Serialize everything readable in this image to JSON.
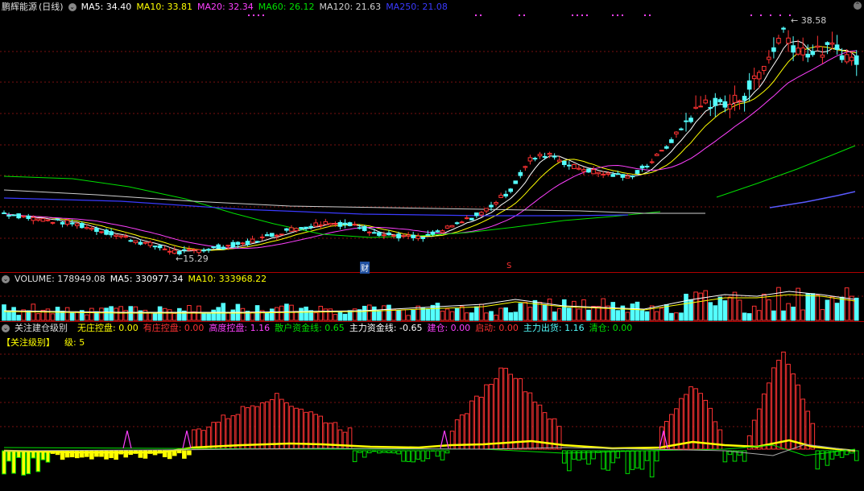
{
  "colors": {
    "up": "#ff3232",
    "down": "#54ffff",
    "ma5": "#ffffff",
    "ma10": "#ffff00",
    "ma20": "#ff40ff",
    "ma60": "#00e000",
    "ma120": "#d0d0d0",
    "ma250": "#3a3aff",
    "grid": "#7a1010"
  },
  "price_panel": {
    "title": "鹏辉能源",
    "period": "(日线)",
    "ma5": "MA5: 34.40",
    "ma10": "MA10: 33.81",
    "ma20": "MA20: 32.34",
    "ma60": "MA60: 26.12",
    "ma120": "MA120: 21.63",
    "ma250": "MA250: 21.08",
    "high_label": "38.58",
    "low_label": "15.29",
    "marker_cai": "财",
    "marker_s": "S"
  },
  "volume_panel": {
    "title": "VOLUME: 178949.08",
    "ma5": "MA5: 330977.34",
    "ma10": "MA10: 333968.22"
  },
  "indicator_panel": {
    "title": "关注建仓级别",
    "items": [
      {
        "label": "无庄控盘: 0.00",
        "color": "#ffff00"
      },
      {
        "label": "有庄控盘: 0.00",
        "color": "#ff3232"
      },
      {
        "label": "高度控盘: 1.16",
        "color": "#ff40ff"
      },
      {
        "label": "散户资金线: 0.65",
        "color": "#00e000"
      },
      {
        "label": "主力资金线: -0.65",
        "color": "#ffffff"
      },
      {
        "label": "建仓: 0.00",
        "color": "#ff40ff"
      },
      {
        "label": "启动: 0.00",
        "color": "#ff3232"
      },
      {
        "label": "主力出货: 1.16",
        "color": "#54ffff"
      },
      {
        "label": "清仓: 0.00",
        "color": "#00e000"
      }
    ],
    "level_label": "【关注级别】",
    "level_value": "级: 5"
  },
  "chart_data": {
    "type": "candlestick",
    "price_extremes": {
      "high": 38.58,
      "low": 15.29
    },
    "last_ma": {
      "ma5": 34.4,
      "ma10": 33.81,
      "ma20": 32.34,
      "ma60": 26.12,
      "ma120": 21.63,
      "ma250": 21.08
    },
    "volume": {
      "last": 178949.08,
      "ma5": 330977.34,
      "ma10": 333968.22
    }
  }
}
